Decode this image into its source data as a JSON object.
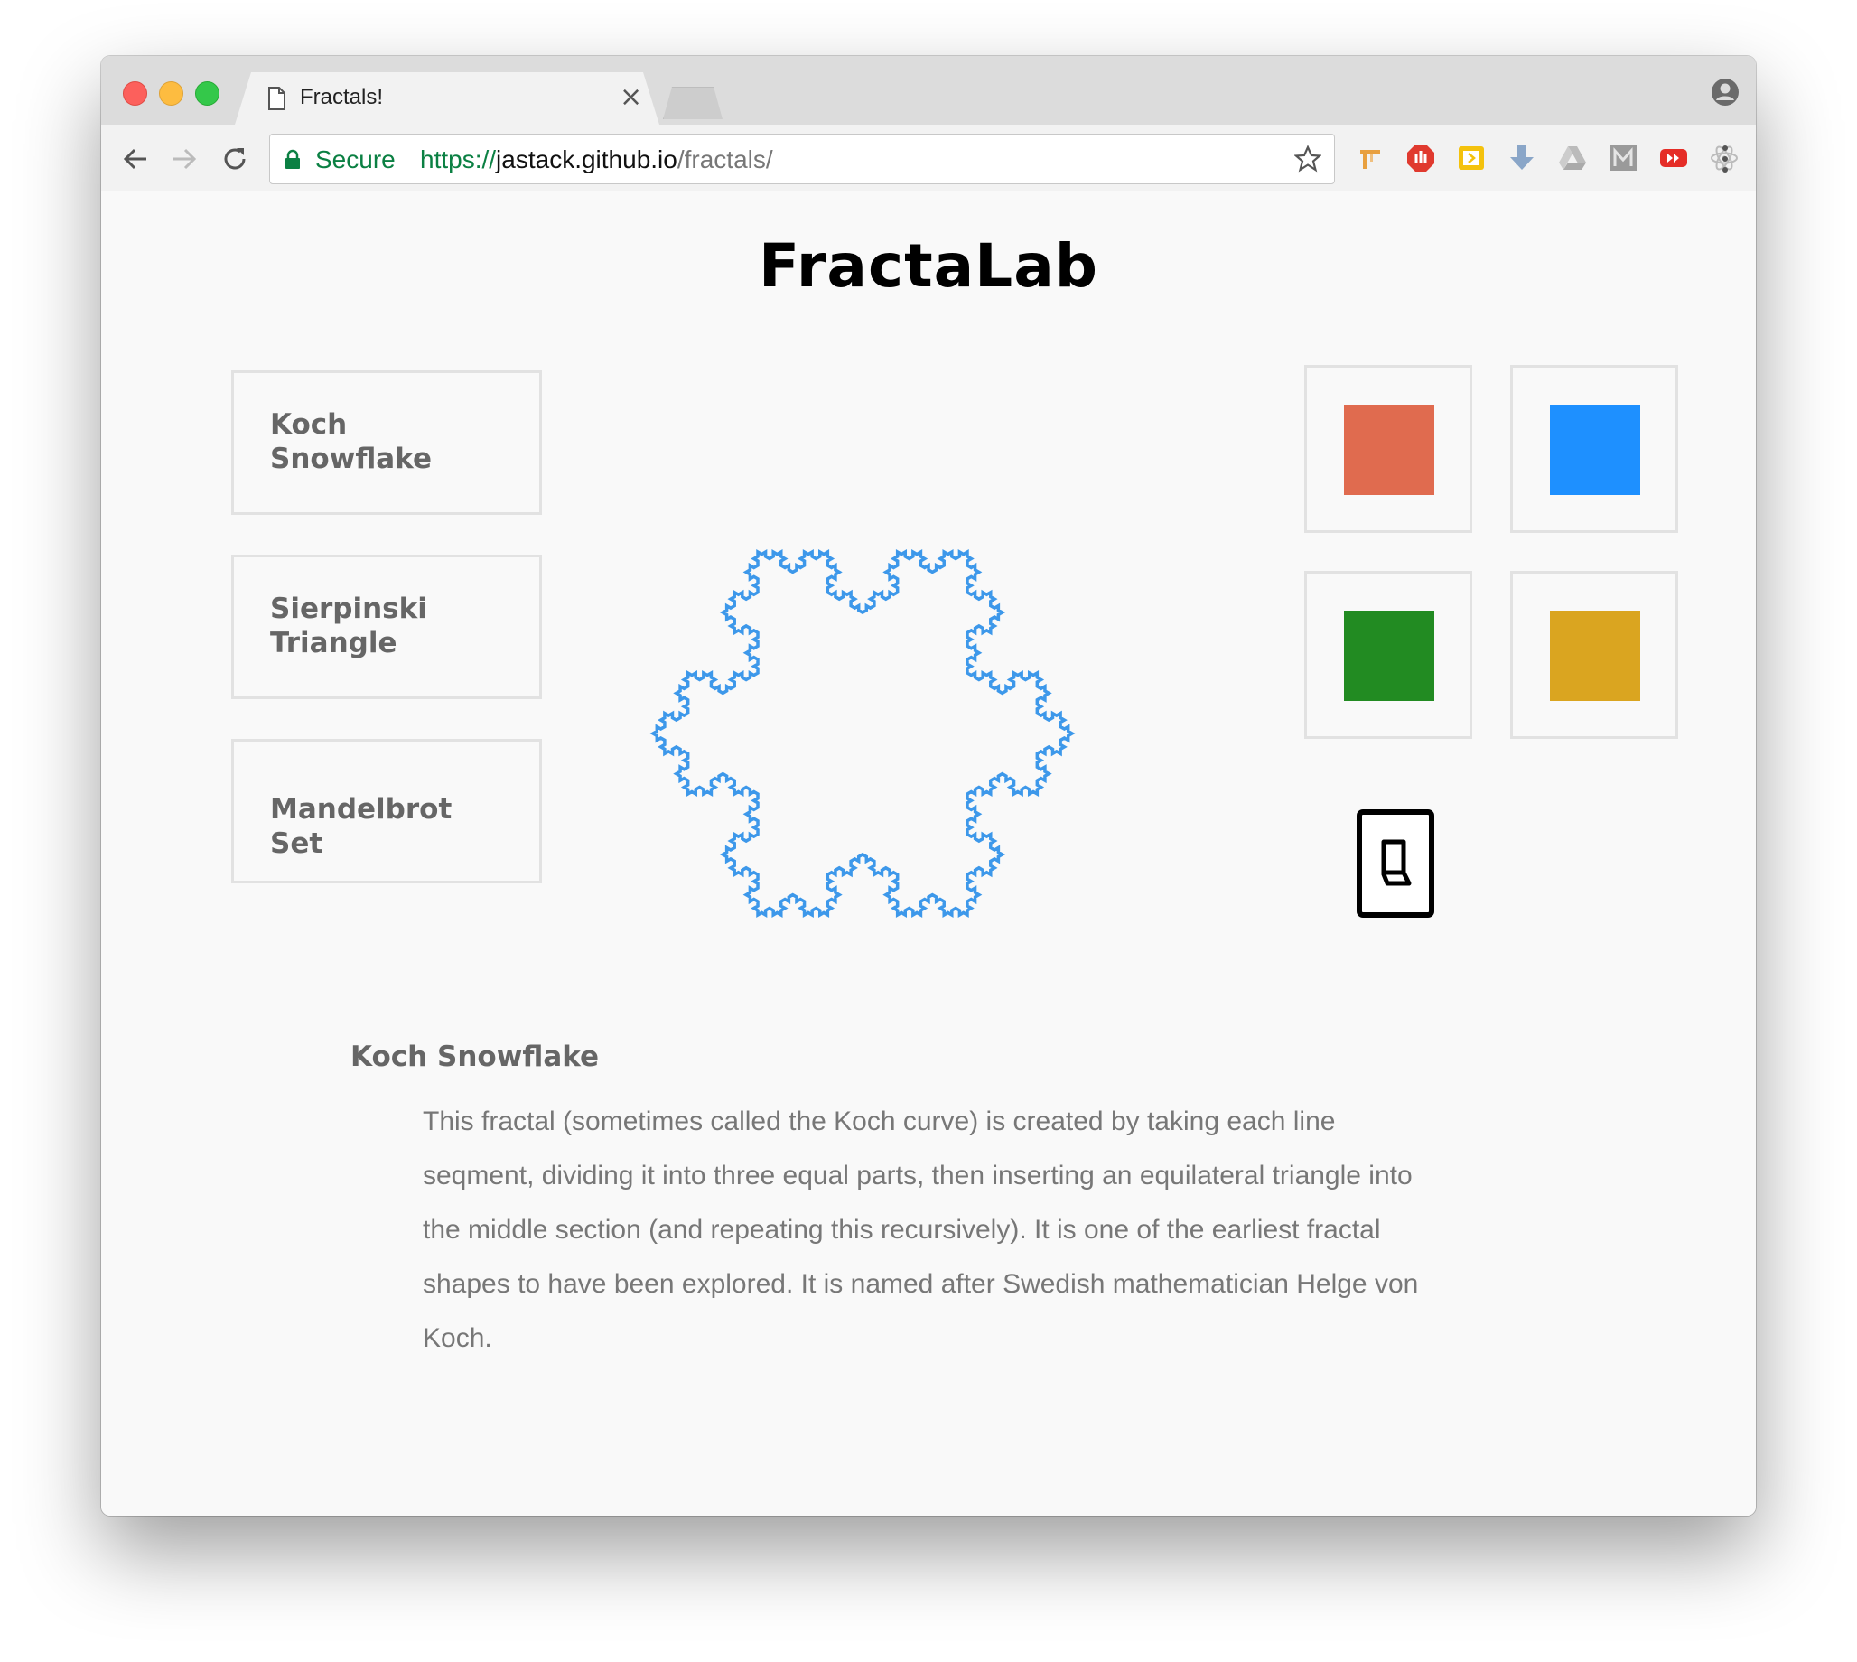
{
  "browser": {
    "tab_title": "Fractals!",
    "close_glyph": "×",
    "secure_label": "Secure",
    "url_scheme": "https://",
    "url_host": "jastack.github.io",
    "url_path": "/fractals/",
    "extensions": [
      "marker-icon",
      "stop-icon",
      "slides-icon",
      "download-icon",
      "drive-icon",
      "m-icon",
      "youtube-icon",
      "react-icon",
      "bird-icon"
    ]
  },
  "page": {
    "title": "FractaLab",
    "fractals": [
      {
        "label_line1": "Koch",
        "label_line2": "Snowflake"
      },
      {
        "label_line1": "Sierpinski",
        "label_line2": "Triangle"
      },
      {
        "label_line1": "Mandelbrot Set",
        "label_line2": ""
      }
    ],
    "colors": [
      {
        "name": "red-orange",
        "hex": "#e06b4f"
      },
      {
        "name": "blue",
        "hex": "#1e90ff"
      },
      {
        "name": "green",
        "hex": "#228b22"
      },
      {
        "name": "goldenrod",
        "hex": "#daa520"
      }
    ],
    "fractal_stroke_color": "#3d98ea",
    "description": {
      "title": "Koch Snowflake",
      "text": "This fractal (sometimes called the Koch curve) is created by taking each line seqment, dividing it into three equal parts, then inserting an equilateral triangle into the middle section (and repeating this recursively). It is one of the earliest fractal shapes to have been explored. It is named after Swedish mathematician Helge von Koch."
    }
  }
}
